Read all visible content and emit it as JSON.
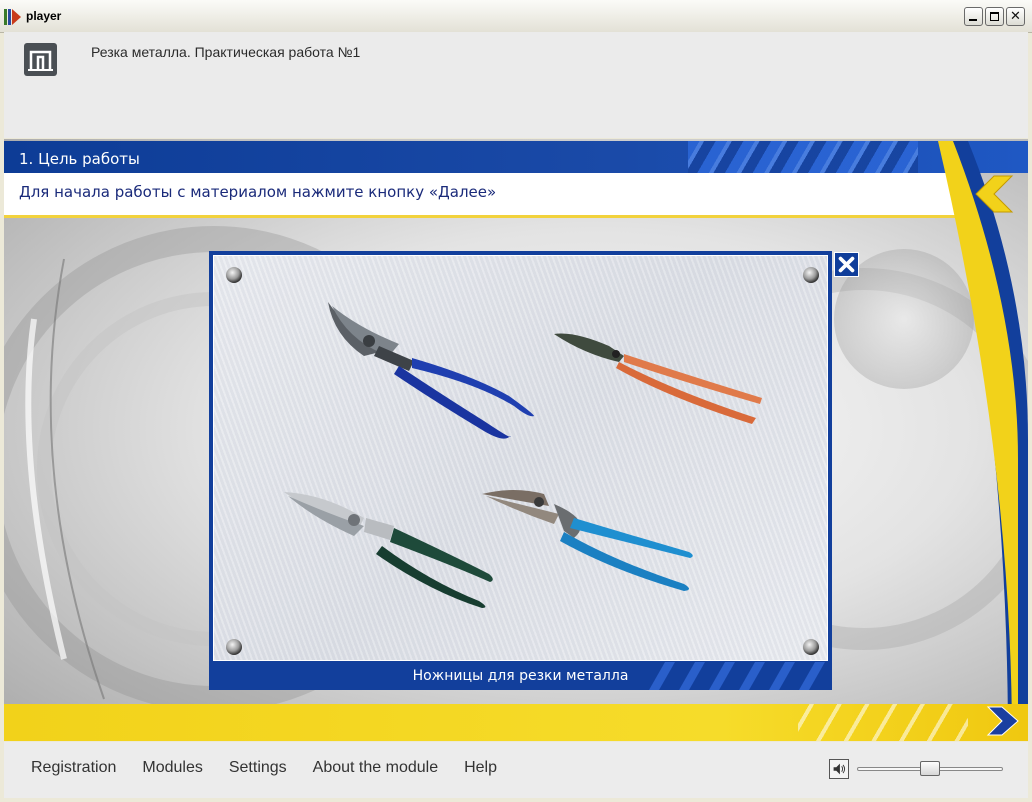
{
  "window": {
    "title": "player"
  },
  "header": {
    "course_title": "Резка металла. Практическая работа №1"
  },
  "section": {
    "title": "1. Цель работы",
    "instruction": "Для начала работы с материалом нажмите кнопку «Далее»"
  },
  "popup": {
    "caption": "Ножницы для резки металла",
    "image_subject": "metal-cutting snips",
    "snips": [
      {
        "name": "snips-blue",
        "handle_color": "#1f3fb0"
      },
      {
        "name": "snips-orange",
        "handle_color": "#e07a4a"
      },
      {
        "name": "snips-green",
        "handle_color": "#1e4a3a"
      },
      {
        "name": "snips-lightblue",
        "handle_color": "#1f8fd0"
      }
    ]
  },
  "menu": {
    "items": [
      {
        "label": "Registration"
      },
      {
        "label": "Modules"
      },
      {
        "label": "Settings"
      },
      {
        "label": "About the module"
      },
      {
        "label": "Help"
      }
    ]
  },
  "volume": {
    "level": 0.5
  },
  "colors": {
    "brand_blue": "#123f9c",
    "accent_yellow": "#f2d21a"
  },
  "icons": [
    "app-icon",
    "logo-icon",
    "minimize-icon",
    "maximize-icon",
    "close-icon",
    "back-arrow-icon",
    "next-arrow-icon",
    "close-popup-icon",
    "speaker-icon"
  ]
}
